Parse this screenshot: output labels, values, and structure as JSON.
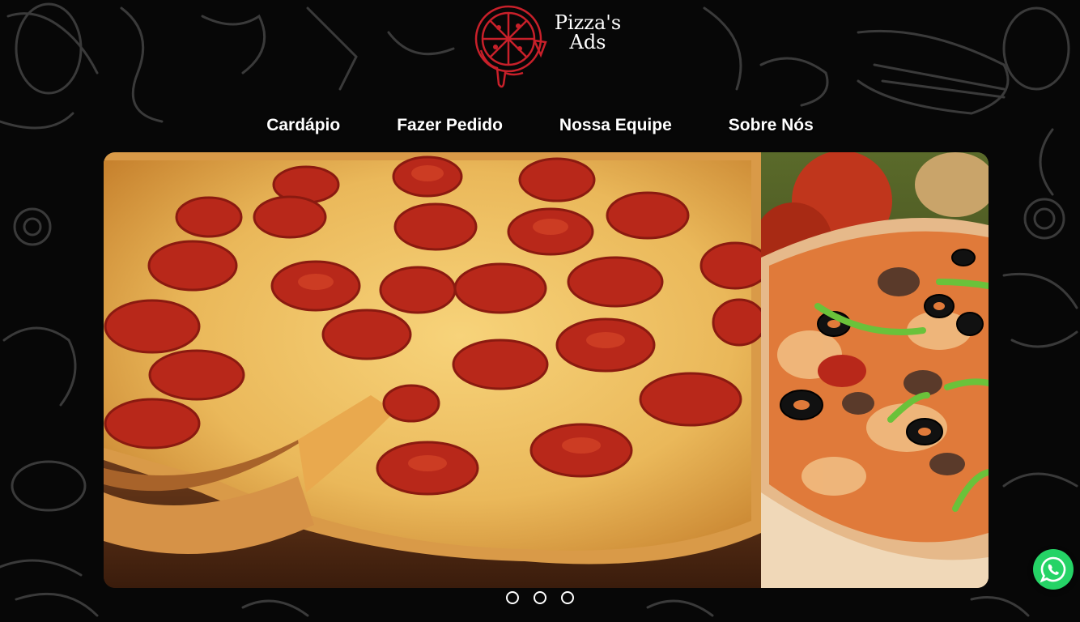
{
  "brand": {
    "name_line1": "Pizza's",
    "name_line2": "Ads",
    "accent_color": "#c8202a"
  },
  "nav": {
    "items": [
      {
        "label": "Cardápio"
      },
      {
        "label": "Fazer Pedido"
      },
      {
        "label": "Nossa Equipe"
      },
      {
        "label": "Sobre Nós"
      }
    ]
  },
  "carousel": {
    "slides": [
      {
        "subject": "pepperoni-pizza"
      },
      {
        "subject": "supreme-pizza"
      }
    ],
    "dot_count": 3
  },
  "floating": {
    "whatsapp_icon": "whatsapp-icon",
    "whatsapp_color": "#25d366"
  }
}
